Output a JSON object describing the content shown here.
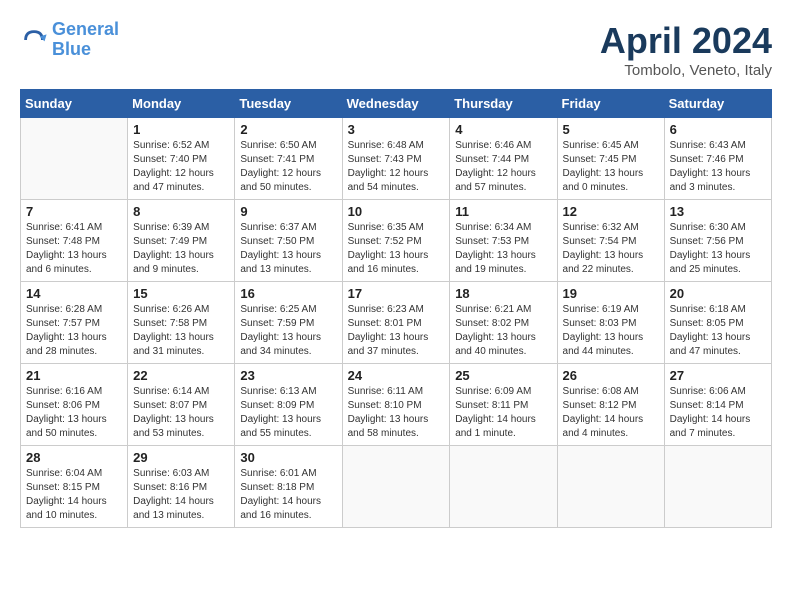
{
  "header": {
    "logo_line1": "General",
    "logo_line2": "Blue",
    "month": "April 2024",
    "location": "Tombolo, Veneto, Italy"
  },
  "days_of_week": [
    "Sunday",
    "Monday",
    "Tuesday",
    "Wednesday",
    "Thursday",
    "Friday",
    "Saturday"
  ],
  "weeks": [
    [
      {
        "day": "",
        "info": ""
      },
      {
        "day": "1",
        "info": "Sunrise: 6:52 AM\nSunset: 7:40 PM\nDaylight: 12 hours\nand 47 minutes."
      },
      {
        "day": "2",
        "info": "Sunrise: 6:50 AM\nSunset: 7:41 PM\nDaylight: 12 hours\nand 50 minutes."
      },
      {
        "day": "3",
        "info": "Sunrise: 6:48 AM\nSunset: 7:43 PM\nDaylight: 12 hours\nand 54 minutes."
      },
      {
        "day": "4",
        "info": "Sunrise: 6:46 AM\nSunset: 7:44 PM\nDaylight: 12 hours\nand 57 minutes."
      },
      {
        "day": "5",
        "info": "Sunrise: 6:45 AM\nSunset: 7:45 PM\nDaylight: 13 hours\nand 0 minutes."
      },
      {
        "day": "6",
        "info": "Sunrise: 6:43 AM\nSunset: 7:46 PM\nDaylight: 13 hours\nand 3 minutes."
      }
    ],
    [
      {
        "day": "7",
        "info": "Sunrise: 6:41 AM\nSunset: 7:48 PM\nDaylight: 13 hours\nand 6 minutes."
      },
      {
        "day": "8",
        "info": "Sunrise: 6:39 AM\nSunset: 7:49 PM\nDaylight: 13 hours\nand 9 minutes."
      },
      {
        "day": "9",
        "info": "Sunrise: 6:37 AM\nSunset: 7:50 PM\nDaylight: 13 hours\nand 13 minutes."
      },
      {
        "day": "10",
        "info": "Sunrise: 6:35 AM\nSunset: 7:52 PM\nDaylight: 13 hours\nand 16 minutes."
      },
      {
        "day": "11",
        "info": "Sunrise: 6:34 AM\nSunset: 7:53 PM\nDaylight: 13 hours\nand 19 minutes."
      },
      {
        "day": "12",
        "info": "Sunrise: 6:32 AM\nSunset: 7:54 PM\nDaylight: 13 hours\nand 22 minutes."
      },
      {
        "day": "13",
        "info": "Sunrise: 6:30 AM\nSunset: 7:56 PM\nDaylight: 13 hours\nand 25 minutes."
      }
    ],
    [
      {
        "day": "14",
        "info": "Sunrise: 6:28 AM\nSunset: 7:57 PM\nDaylight: 13 hours\nand 28 minutes."
      },
      {
        "day": "15",
        "info": "Sunrise: 6:26 AM\nSunset: 7:58 PM\nDaylight: 13 hours\nand 31 minutes."
      },
      {
        "day": "16",
        "info": "Sunrise: 6:25 AM\nSunset: 7:59 PM\nDaylight: 13 hours\nand 34 minutes."
      },
      {
        "day": "17",
        "info": "Sunrise: 6:23 AM\nSunset: 8:01 PM\nDaylight: 13 hours\nand 37 minutes."
      },
      {
        "day": "18",
        "info": "Sunrise: 6:21 AM\nSunset: 8:02 PM\nDaylight: 13 hours\nand 40 minutes."
      },
      {
        "day": "19",
        "info": "Sunrise: 6:19 AM\nSunset: 8:03 PM\nDaylight: 13 hours\nand 44 minutes."
      },
      {
        "day": "20",
        "info": "Sunrise: 6:18 AM\nSunset: 8:05 PM\nDaylight: 13 hours\nand 47 minutes."
      }
    ],
    [
      {
        "day": "21",
        "info": "Sunrise: 6:16 AM\nSunset: 8:06 PM\nDaylight: 13 hours\nand 50 minutes."
      },
      {
        "day": "22",
        "info": "Sunrise: 6:14 AM\nSunset: 8:07 PM\nDaylight: 13 hours\nand 53 minutes."
      },
      {
        "day": "23",
        "info": "Sunrise: 6:13 AM\nSunset: 8:09 PM\nDaylight: 13 hours\nand 55 minutes."
      },
      {
        "day": "24",
        "info": "Sunrise: 6:11 AM\nSunset: 8:10 PM\nDaylight: 13 hours\nand 58 minutes."
      },
      {
        "day": "25",
        "info": "Sunrise: 6:09 AM\nSunset: 8:11 PM\nDaylight: 14 hours\nand 1 minute."
      },
      {
        "day": "26",
        "info": "Sunrise: 6:08 AM\nSunset: 8:12 PM\nDaylight: 14 hours\nand 4 minutes."
      },
      {
        "day": "27",
        "info": "Sunrise: 6:06 AM\nSunset: 8:14 PM\nDaylight: 14 hours\nand 7 minutes."
      }
    ],
    [
      {
        "day": "28",
        "info": "Sunrise: 6:04 AM\nSunset: 8:15 PM\nDaylight: 14 hours\nand 10 minutes."
      },
      {
        "day": "29",
        "info": "Sunrise: 6:03 AM\nSunset: 8:16 PM\nDaylight: 14 hours\nand 13 minutes."
      },
      {
        "day": "30",
        "info": "Sunrise: 6:01 AM\nSunset: 8:18 PM\nDaylight: 14 hours\nand 16 minutes."
      },
      {
        "day": "",
        "info": ""
      },
      {
        "day": "",
        "info": ""
      },
      {
        "day": "",
        "info": ""
      },
      {
        "day": "",
        "info": ""
      }
    ]
  ]
}
